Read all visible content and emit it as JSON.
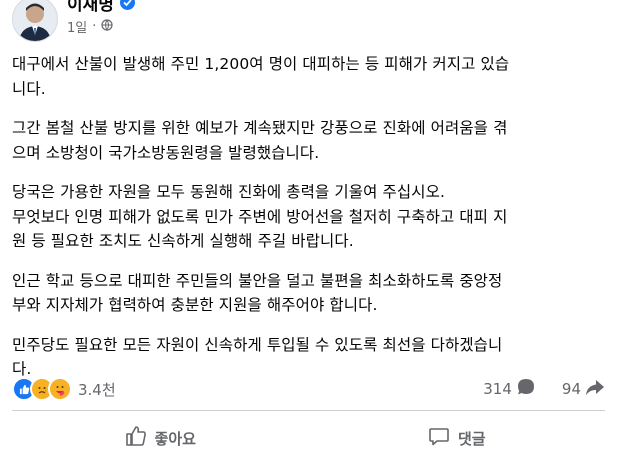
{
  "post": {
    "author": "이재명",
    "time": "1일",
    "paragraphs": [
      "대구에서 산불이 발생해 주민 1,200여 명이 대피하는 등 피해가 커지고 있습\n니다.",
      "그간 봄철 산불 방지를 위한 예보가 계속됐지만 강풍으로 진화에 어려움을 겪\n으며 소방청이 국가소방동원령을 발령했습니다.",
      "당국은 가용한 자원을 모두 동원해 진화에 총력을 기울여 주십시오.\n무엇보다 인명 피해가 없도록 민가 주변에 방어선을 철저히 구축하고 대피 지\n원 등 필요한 조치도 신속하게 실행해 주길 바랍니다.",
      "인근 학교 등으로 대피한 주민들의 불안을 덜고 불편을 최소화하도록 중앙정\n부와 지자체가 협력하여 충분한 지원을 해주어야 합니다.",
      "민주당도 필요한 모든 자원이 신속하게 투입될 수 있도록 최선을 다하겠습니\n다."
    ]
  },
  "reactions": {
    "icons": [
      "like-icon",
      "sad-icon",
      "care-icon"
    ],
    "count": "3.4천",
    "comments": "314",
    "shares": "94"
  },
  "actions": {
    "like_label": "좋아요",
    "comment_label": "댓글"
  },
  "colors": {
    "accent": "#1877f2",
    "muted": "#65676b",
    "text": "#050505"
  }
}
